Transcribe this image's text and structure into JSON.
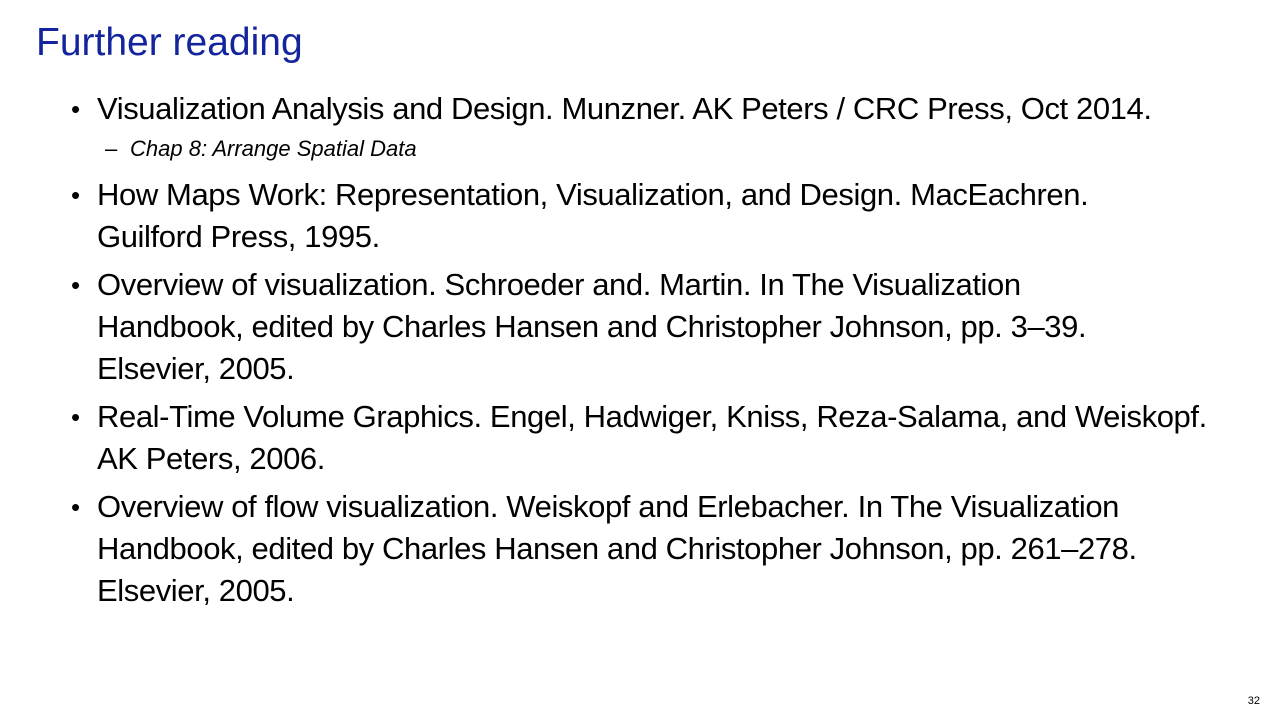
{
  "slide": {
    "title": "Further reading",
    "page_number": "32",
    "references": [
      {
        "lines": [
          "Visualization Analysis and Design. Munzner.  AK Peters / CRC Press, Oct 2014."
        ],
        "sub": "Chap 8: Arrange Spatial Data"
      },
      {
        "lines": [
          "How Maps Work: Representation, Visualization, and Design. MacEachren.",
          "Guilford Press, 1995."
        ]
      },
      {
        "lines": [
          "Overview of visualization. Schroeder and. Martin. In The Visualization",
          "Handbook, edited by Charles Hansen and Christopher Johnson, pp. 3–39.",
          "Elsevier, 2005."
        ]
      },
      {
        "lines": [
          "Real-Time Volume Graphics. Engel, Hadwiger, Kniss, Reza-Salama, and Weiskopf.",
          "AK Peters, 2006."
        ]
      },
      {
        "lines": [
          "Overview of flow visualization. Weiskopf and Erlebacher. In The Visualization",
          "Handbook, edited by Charles Hansen and Christopher Johnson, pp. 261–278.",
          "Elsevier, 2005."
        ]
      }
    ]
  }
}
